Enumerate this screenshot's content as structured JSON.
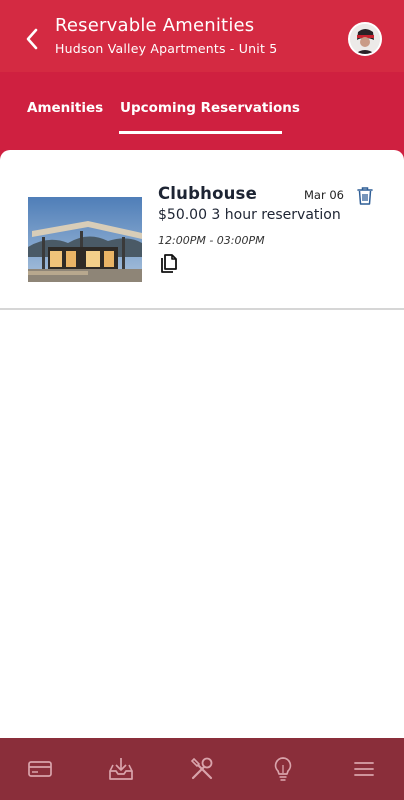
{
  "header": {
    "title": "Reservable Amenities",
    "subtitle": "Hudson Valley Apartments - Unit 5"
  },
  "tabs": [
    {
      "label": "Amenities",
      "active": false
    },
    {
      "label": "Upcoming Reservations",
      "active": true
    }
  ],
  "reservations": [
    {
      "name": "Clubhouse",
      "date": "Mar 06",
      "description": "$50.00 3 hour reservation",
      "time": "12:00PM - 03:00PM",
      "image": "clubhouse-photo"
    }
  ],
  "bottom_nav": [
    {
      "icon": "card-icon"
    },
    {
      "icon": "inbox-download-icon"
    },
    {
      "icon": "tools-icon"
    },
    {
      "icon": "lightbulb-icon"
    },
    {
      "icon": "menu-icon"
    }
  ],
  "colors": {
    "header_red": "#d42a42",
    "tab_red": "#cf2040",
    "nav_maroon": "#8a2e3a",
    "icon_blue": "#2f5e96"
  }
}
